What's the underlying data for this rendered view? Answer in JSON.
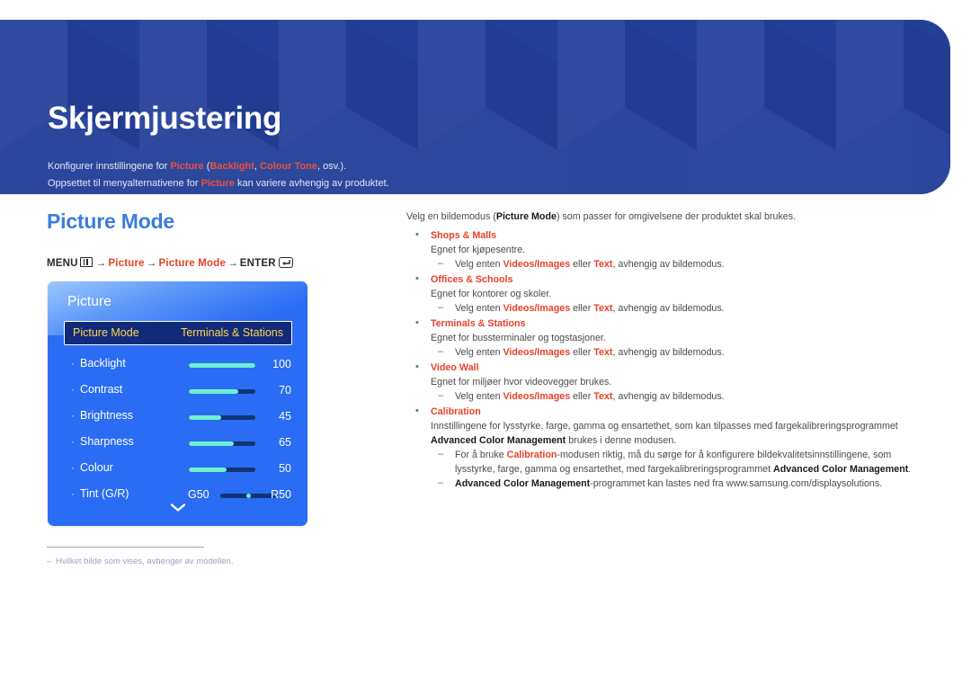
{
  "banner": {
    "title": "Skjermjustering",
    "line1": {
      "pre": "Konfigurer innstillingene for ",
      "t1": "Picture",
      "mid1": " (",
      "t2": "Backlight",
      "mid2": ", ",
      "t3": "Colour Tone",
      "post": ", osv.)."
    },
    "line2": {
      "pre": "Oppsettet til menyalternativene for ",
      "t1": "Picture",
      "post": " kan variere avhengig av produktet."
    }
  },
  "page_title": "Picture Mode",
  "menu_path": {
    "menu_label": "MENU",
    "menu_icon": "menu-bars-icon",
    "arrow": "→",
    "step1": "Picture",
    "step2": "Picture Mode",
    "enter_label": "ENTER",
    "enter_icon": "enter-key-icon"
  },
  "osd": {
    "header": "Picture",
    "selected_row": {
      "label": "Picture Mode",
      "value": "Terminals & Stations"
    },
    "rows": [
      {
        "label": "Backlight",
        "value": "100",
        "percent": 100
      },
      {
        "label": "Contrast",
        "value": "70",
        "percent": 70
      },
      {
        "label": "Brightness",
        "value": "45",
        "percent": 45
      },
      {
        "label": "Sharpness",
        "value": "65",
        "percent": 65
      },
      {
        "label": "Colour",
        "value": "50",
        "percent": 50
      }
    ],
    "tint_row": {
      "label": "Tint (G/R)",
      "left_label": "G50",
      "right_label": "R50",
      "knob_percent": 50
    },
    "scroll_chevron": "chevron-down-icon"
  },
  "footnote": {
    "dash": "–",
    "text": "Hvilket bilde som vises, avhenger av modellen."
  },
  "content": {
    "intro": {
      "pre": "Velg en bildemodus (",
      "term": "Picture Mode",
      "post": ") som passer for omgivelsene der produktet skal brukes."
    },
    "sub_note": {
      "pre": "Velg enten ",
      "t1": "Videos/Images",
      "mid": " eller ",
      "t2": "Text",
      "post": ", avhengig av bildemodus."
    },
    "items": [
      {
        "title": "Shops & Malls",
        "desc": "Egnet for kjøpesentre."
      },
      {
        "title": "Offices & Schools",
        "desc": "Egnet for kontorer og skoler."
      },
      {
        "title": "Terminals & Stations",
        "desc": "Egnet for bussterminaler og togstasjoner."
      },
      {
        "title": "Video Wall",
        "desc": "Egnet for miljøer hvor videovegger brukes."
      }
    ],
    "calibration": {
      "title": "Calibration",
      "desc_pre": "Innstillingene for lysstyrke, farge, gamma og ensartethet, som kan tilpasses med fargekalibreringsprogrammet ",
      "desc_bold": "Advanced Color Management",
      "desc_post": " brukes i denne modusen.",
      "bullet1_pre": "For å bruke ",
      "bullet1_red": "Calibration",
      "bullet1_mid": "-modusen riktig, må du sørge for å konfigurere bildekvalitetsinnstillingene, som lysstyrke, farge, gamma og ensartethet, med fargekalibreringsprogrammet ",
      "bullet1_bold": "Advanced Color Management",
      "bullet1_post": ".",
      "bullet2_bold": "Advanced Color Management",
      "bullet2_post": "-programmet kan lastes ned fra www.samsung.com/displaysolutions."
    }
  },
  "colors": {
    "banner_bg": "#234099",
    "accent_red": "#e8402a",
    "title_blue": "#3b7ddd",
    "osd_blue": "#2a6cf4",
    "osd_selected": "#112a7a",
    "osd_yellow": "#ffd84d",
    "slider_fill": "#6ef0d0"
  }
}
